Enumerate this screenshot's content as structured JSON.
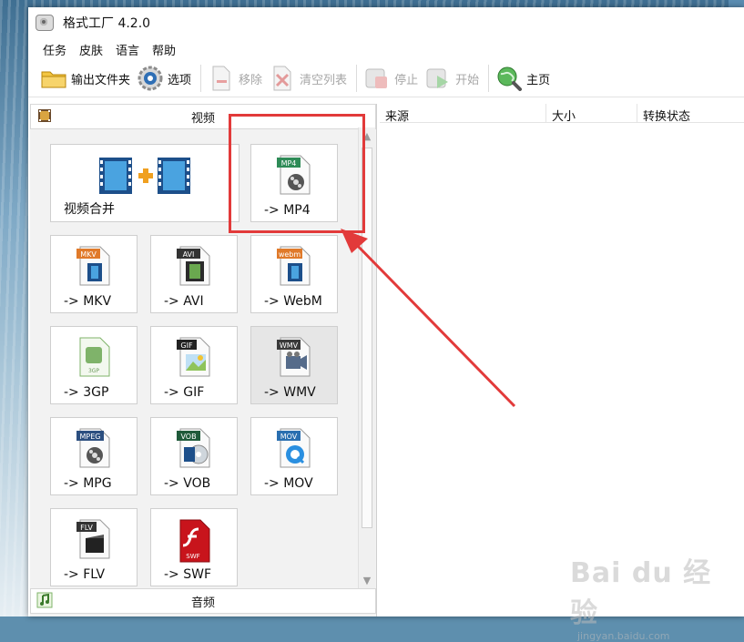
{
  "window": {
    "title": "格式工厂 4.2.0"
  },
  "menu": [
    "任务",
    "皮肤",
    "语言",
    "帮助"
  ],
  "toolbar": {
    "output_folder": "输出文件夹",
    "options": "选项",
    "remove": "移除",
    "clear_list": "清空列表",
    "stop": "停止",
    "start": "开始",
    "home": "主页"
  },
  "video_panel": {
    "header": "视频",
    "tiles": [
      {
        "label": "视频合并",
        "badge": ""
      },
      {
        "label": "-> MP4",
        "badge": "MP4"
      },
      {
        "label": "-> MKV",
        "badge": "MKV"
      },
      {
        "label": "-> AVI",
        "badge": "AVI"
      },
      {
        "label": "-> WebM",
        "badge": "webm"
      },
      {
        "label": "-> 3GP",
        "badge": "3GP"
      },
      {
        "label": "-> GIF",
        "badge": "GIF"
      },
      {
        "label": "-> WMV",
        "badge": "WMV"
      },
      {
        "label": "-> MPG",
        "badge": "MPEG"
      },
      {
        "label": "-> VOB",
        "badge": "VOB"
      },
      {
        "label": "-> MOV",
        "badge": "MOV"
      },
      {
        "label": "-> FLV",
        "badge": "FLV"
      },
      {
        "label": "-> SWF",
        "badge": "SWF"
      }
    ]
  },
  "audio_panel": {
    "header": "音频"
  },
  "task_table": {
    "columns": [
      "来源",
      "大小",
      "转换状态"
    ]
  },
  "watermark": {
    "main": "Bai du 经验",
    "sub": "jingyan.baidu.com"
  },
  "colors": {
    "highlight": "#e23a3a",
    "accent_orange": "#f0a020",
    "film_blue": "#2f6fb5"
  }
}
